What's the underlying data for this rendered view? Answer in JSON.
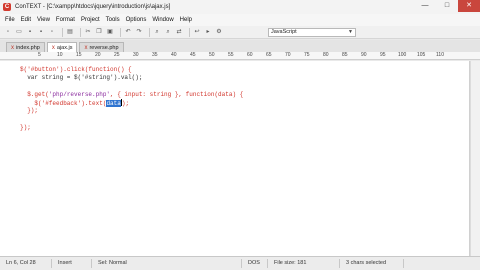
{
  "window": {
    "title": "ConTEXT - [C:\\xampp\\htdocs\\jquery\\introduction\\js\\ajax.js]",
    "app_icon_glyph": "C",
    "minimize": "—",
    "maximize": "□",
    "close": "✕"
  },
  "menu": [
    "File",
    "Edit",
    "View",
    "Format",
    "Project",
    "Tools",
    "Options",
    "Window",
    "Help"
  ],
  "toolbar": {
    "language": "JavaScript"
  },
  "tabs": [
    {
      "label": "index.php",
      "active": false
    },
    {
      "label": "ajax.js",
      "active": true
    },
    {
      "label": "reverse.php",
      "active": false
    }
  ],
  "ruler": [
    "5",
    "10",
    "15",
    "20",
    "25",
    "30",
    "35",
    "40",
    "45",
    "50",
    "55",
    "60",
    "65",
    "70",
    "75",
    "80",
    "85",
    "90",
    "95",
    "100",
    "105",
    "110"
  ],
  "code": {
    "line1a": "$('#button')",
    "line1b": ".click(function() {",
    "line2": "  var string = $('#string').val();",
    "line3a": "  $.get(",
    "line3b": "'php/reverse.php'",
    "line3c": ", { input: string }, function(data) {",
    "line4a": "    $('#feedback').",
    "line4b": "text(",
    "line4sel": "data",
    "line4c": ");",
    "line5": "  });",
    "line6": "});"
  },
  "status": {
    "position": "Ln 6, Col 28",
    "mode": "Insert",
    "sel_mode": "Sel: Normal",
    "code": "DOS",
    "file_size": "File size: 181",
    "selection": "3 chars selected"
  }
}
